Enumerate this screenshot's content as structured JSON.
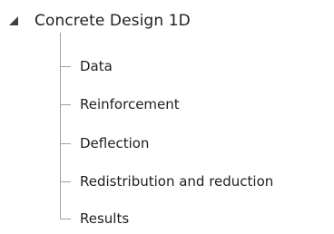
{
  "tree": {
    "root": {
      "label": "Concrete Design 1D",
      "expander_icon": "triangle-expanded-icon"
    },
    "children": [
      {
        "label": "Data"
      },
      {
        "label": "Reinforcement"
      },
      {
        "label": "Deflection"
      },
      {
        "label": "Redistribution and reduction"
      },
      {
        "label": "Results"
      }
    ]
  },
  "colors": {
    "text": "#1e1e1e",
    "connector": "#a0a0a0",
    "expander": "#404040",
    "background": "#ffffff"
  }
}
